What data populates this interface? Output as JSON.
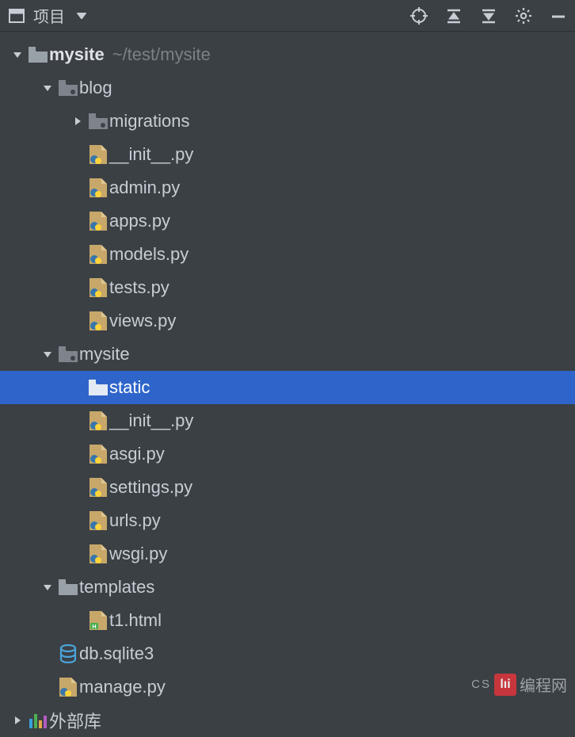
{
  "toolbar": {
    "title": "项目"
  },
  "tree": {
    "root": {
      "name": "mysite",
      "path": "~/test/mysite"
    },
    "blog": {
      "name": "blog",
      "migrations": "migrations",
      "files": [
        "__init__.py",
        "admin.py",
        "apps.py",
        "models.py",
        "tests.py",
        "views.py"
      ]
    },
    "mysite": {
      "name": "mysite",
      "static": "static",
      "files": [
        "__init__.py",
        "asgi.py",
        "settings.py",
        "urls.py",
        "wsgi.py"
      ]
    },
    "templates": {
      "name": "templates",
      "files": [
        "t1.html"
      ]
    },
    "rootFiles": {
      "db": "db.sqlite3",
      "manage": "manage.py"
    },
    "external": "外部库"
  },
  "watermark": {
    "pretext": "CS",
    "boxtext": "lıi",
    "text": "编程网"
  }
}
